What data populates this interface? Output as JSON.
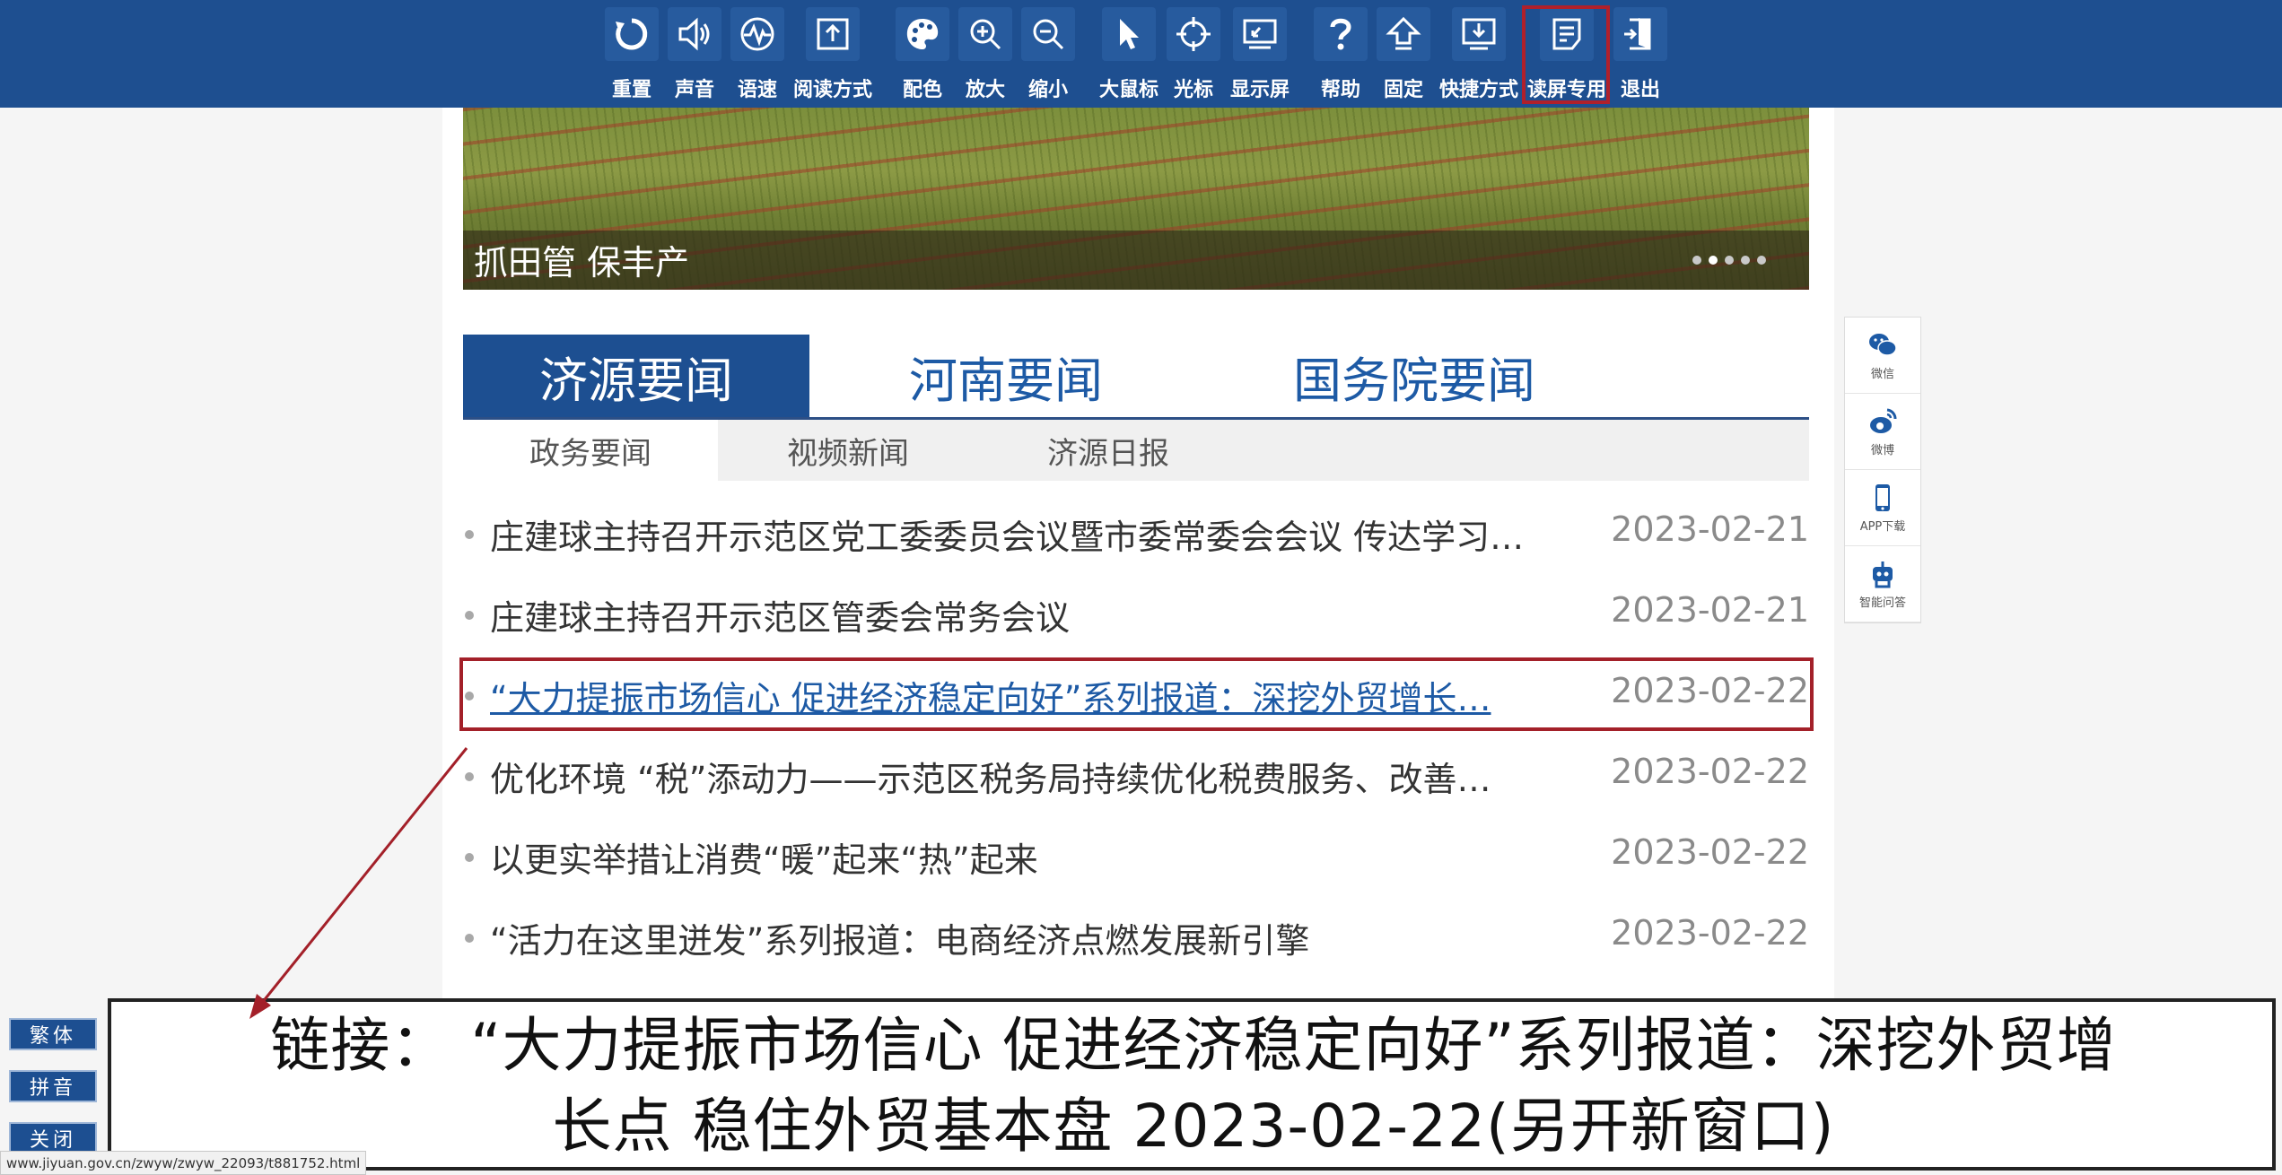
{
  "toolbar": {
    "items": [
      {
        "label": "重置",
        "icon": "refresh-icon"
      },
      {
        "label": "声音",
        "icon": "speaker-icon"
      },
      {
        "label": "语速",
        "icon": "speed-wave-icon"
      },
      {
        "label": "阅读方式",
        "icon": "reading-mode-icon"
      },
      {
        "label": "配色",
        "icon": "palette-icon"
      },
      {
        "label": "放大",
        "icon": "zoom-in-icon"
      },
      {
        "label": "缩小",
        "icon": "zoom-out-icon"
      },
      {
        "label": "大鼠标",
        "icon": "big-cursor-icon"
      },
      {
        "label": "光标",
        "icon": "crosshair-icon"
      },
      {
        "label": "显示屏",
        "icon": "display-screen-icon"
      },
      {
        "label": "帮助",
        "icon": "help-icon"
      },
      {
        "label": "固定",
        "icon": "pin-up-icon"
      },
      {
        "label": "快捷方式",
        "icon": "shortcut-download-icon"
      },
      {
        "label": "读屏专用",
        "icon": "screen-reader-icon"
      },
      {
        "label": "退出",
        "icon": "exit-door-icon"
      }
    ],
    "highlight_color": "#b0202b"
  },
  "banner": {
    "caption": "抓田管 保丰产",
    "slide_count": 5,
    "active_slide": 2
  },
  "main_tabs": [
    "济源要闻",
    "河南要闻",
    "国务院要闻"
  ],
  "sub_tabs": [
    "政务要闻",
    "视频新闻",
    "济源日报"
  ],
  "news": [
    {
      "title": "庄建球主持召开示范区党工委委员会议暨市委常委会会议 传达学习…",
      "date": "2023-02-21"
    },
    {
      "title": "庄建球主持召开示范区管委会常务会议",
      "date": "2023-02-21"
    },
    {
      "title": "“大力提振市场信心 促进经济稳定向好”系列报道：深挖外贸增长…",
      "date": "2023-02-22"
    },
    {
      "title": "优化环境 “税”添动力——示范区税务局持续优化税费服务、改善…",
      "date": "2023-02-22"
    },
    {
      "title": "以更实举措让消费“暖”起来“热”起来",
      "date": "2023-02-22"
    },
    {
      "title": "“活力在这里迸发”系列报道：电商经济点燃发展新引擎",
      "date": "2023-02-22"
    }
  ],
  "share_bar": [
    {
      "label": "微信",
      "icon": "wechat-icon"
    },
    {
      "label": "微博",
      "icon": "weibo-icon"
    },
    {
      "label": "APP下载",
      "icon": "phone-app-icon"
    },
    {
      "label": "智能问答",
      "icon": "robot-icon"
    }
  ],
  "lang_buttons": [
    "繁体",
    "拼音",
    "关闭"
  ],
  "reading_panel": {
    "line1": "链接：  “大力提振市场信心 促进经济稳定向好”系列报道：深挖外贸增",
    "line2": "长点 稳住外贸基本盘 2023-02-22(另开新窗口)"
  },
  "status_url": "www.jiyuan.gov.cn/zwyw/zwyw_22093/t881752.html",
  "colors": {
    "toolbar_bg": "#1e4f90",
    "active_tab_bg": "#1d4f91",
    "link_blue": "#1d5aa5",
    "focus_red": "#a32029"
  }
}
